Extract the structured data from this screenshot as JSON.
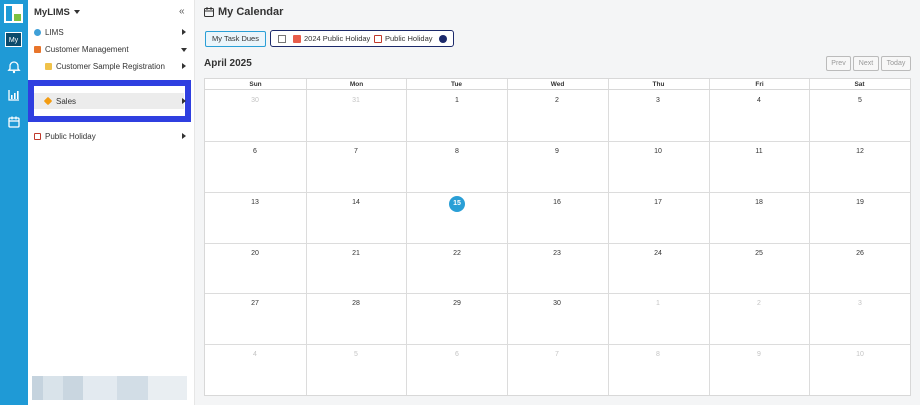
{
  "app": {
    "name": "MyLIMS",
    "rail_my_label": "My"
  },
  "sidebar": {
    "items": [
      {
        "label": "LIMS",
        "icon": "globe-icon"
      },
      {
        "label": "Customer Management",
        "icon": "shield-icon"
      },
      {
        "label": "Customer Sample Registration",
        "icon": "document-icon"
      },
      {
        "label": "Sales",
        "icon": "diamond-icon"
      },
      {
        "label": "Public Holiday",
        "icon": "calendar-icon"
      }
    ]
  },
  "page": {
    "title": "My Calendar"
  },
  "toolbar": {
    "task_dues_label": "My Task Dues",
    "filter_2024_label": "2024 Public Holiday",
    "filter_public_label": "Public Holiday",
    "dot_color": "#1c2a6b"
  },
  "calendar": {
    "month_label": "April 2025",
    "prev_label": "Prev",
    "next_label": "Next",
    "today_label": "Today",
    "weekdays": [
      "Sun",
      "Mon",
      "Tue",
      "Wed",
      "Thu",
      "Fri",
      "Sat"
    ],
    "weeks": [
      [
        "30",
        "31",
        "1",
        "2",
        "3",
        "4",
        "5"
      ],
      [
        "6",
        "7",
        "8",
        "9",
        "10",
        "11",
        "12"
      ],
      [
        "13",
        "14",
        "15",
        "16",
        "17",
        "18",
        "19"
      ],
      [
        "20",
        "21",
        "22",
        "23",
        "24",
        "25",
        "26"
      ],
      [
        "27",
        "28",
        "29",
        "30",
        "1",
        "2",
        "3"
      ],
      [
        "4",
        "5",
        "6",
        "7",
        "8",
        "9",
        "10"
      ]
    ],
    "today": "15",
    "accent_color": "#2a9fd6"
  }
}
